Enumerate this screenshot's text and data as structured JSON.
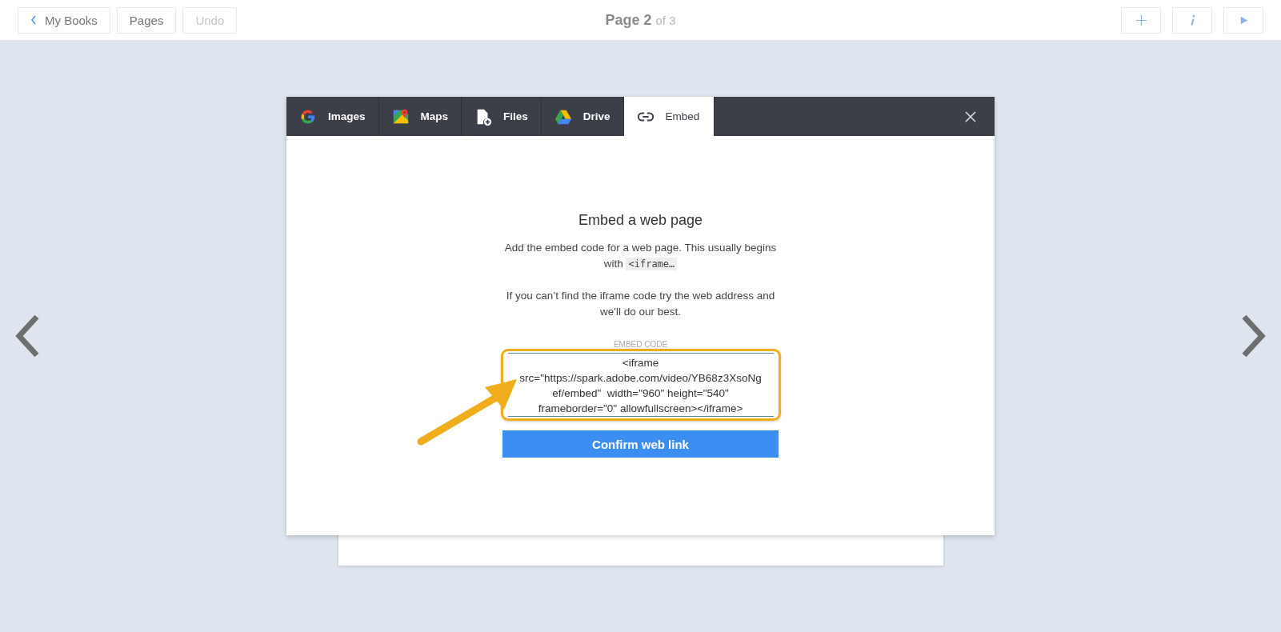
{
  "top_bar": {
    "buttons": [
      {
        "kind": "back",
        "label": "My Books",
        "disabled": false
      },
      {
        "kind": "plain",
        "label": "Pages",
        "disabled": false
      },
      {
        "kind": "plain",
        "label": "Undo",
        "disabled": true
      }
    ],
    "page_title": "Page 2",
    "page_count": "of 3",
    "tools": [
      {
        "kind": "add"
      },
      {
        "kind": "info"
      },
      {
        "kind": "play"
      }
    ]
  },
  "dialog": {
    "tabs": [
      {
        "label": "Images",
        "kind": "google",
        "selected": false
      },
      {
        "label": "Maps",
        "kind": "maps",
        "selected": false
      },
      {
        "label": "Files",
        "kind": "file",
        "selected": false
      },
      {
        "label": "Drive",
        "kind": "drive",
        "selected": false
      },
      {
        "label": "Embed",
        "kind": "link",
        "selected": true
      }
    ],
    "heading": "Embed a web page",
    "description": "Add the embed code for a web page. This usually begins with",
    "code_snippet": "<iframe…",
    "hint": "If you can’t find the iframe code try the web address and we'll do our best.",
    "field_label": "EMBED CODE",
    "embed_code": "<iframe src=\"https://spark.adobe.com/video/YB68z3XsoNgef/embed\"  width=\"960\" height=\"540\" frameborder=\"0\" allowfullscreen></iframe>",
    "confirm_button": "Confirm web link"
  }
}
